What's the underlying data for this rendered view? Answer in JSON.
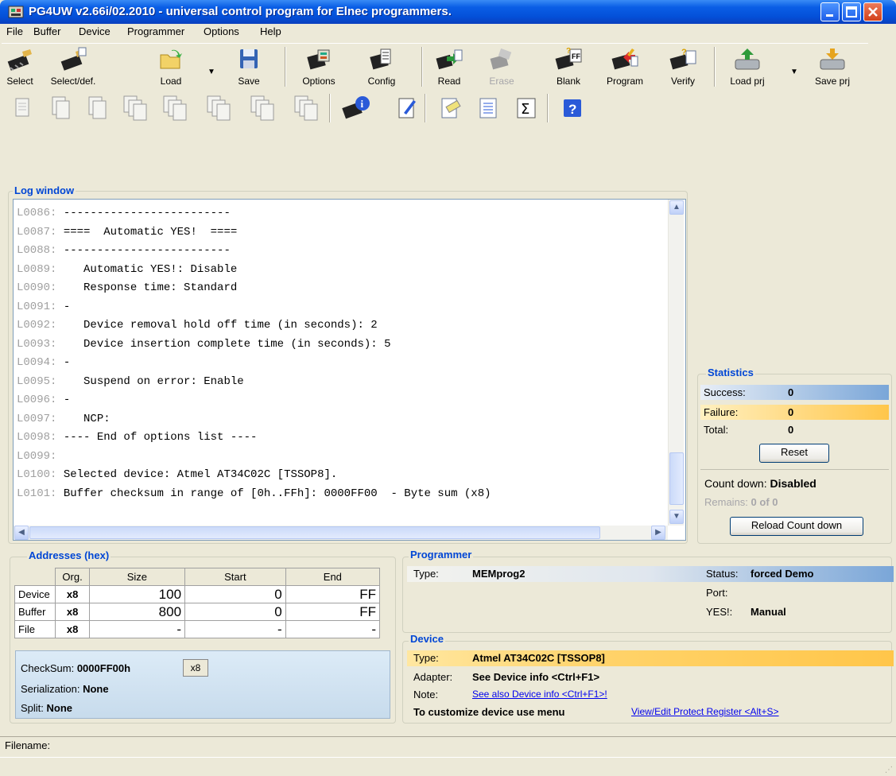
{
  "window": {
    "title": "PG4UW v2.66i/02.2010 - universal control program for Elnec programmers."
  },
  "menu": [
    "File",
    "Buffer",
    "Device",
    "Programmer",
    "Options",
    "Help"
  ],
  "toolbar": {
    "select": "Select",
    "select_def": "Select/def.",
    "load": "Load",
    "save": "Save",
    "options": "Options",
    "config": "Config",
    "read": "Read",
    "erase": "Erase",
    "blank": "Blank",
    "program": "Program",
    "verify": "Verify",
    "load_prj": "Load prj",
    "save_prj": "Save prj",
    "blank_badge": "FF",
    "checksum_glyph": "Σ",
    "help_glyph": "?"
  },
  "log": {
    "title": "Log window",
    "lines": [
      {
        "n": "L0086:",
        "t": " -------------------------"
      },
      {
        "n": "L0087:",
        "t": " ====  Automatic YES!  ===="
      },
      {
        "n": "L0088:",
        "t": " -------------------------"
      },
      {
        "n": "L0089:",
        "t": "    Automatic YES!: Disable"
      },
      {
        "n": "L0090:",
        "t": "    Response time: Standard"
      },
      {
        "n": "L0091:",
        "t": " -"
      },
      {
        "n": "L0092:",
        "t": "    Device removal hold off time (in seconds): 2"
      },
      {
        "n": "L0093:",
        "t": "    Device insertion complete time (in seconds): 5"
      },
      {
        "n": "L0094:",
        "t": " -"
      },
      {
        "n": "L0095:",
        "t": "    Suspend on error: Enable"
      },
      {
        "n": "L0096:",
        "t": " -"
      },
      {
        "n": "L0097:",
        "t": "    NCP:"
      },
      {
        "n": "L0098:",
        "t": " ---- End of options list ----"
      },
      {
        "n": "L0099:",
        "t": ""
      },
      {
        "n": "L0100:",
        "t": " Selected device: Atmel AT34C02C [TSSOP8]."
      },
      {
        "n": "L0101:",
        "t": " Buffer checksum in range of [0h..FFh]: 0000FF00  - Byte sum (x8)"
      }
    ],
    "scroll_up": "▲",
    "scroll_down": "▼",
    "scroll_left": "◀",
    "scroll_right": "▶"
  },
  "statistics": {
    "title": "Statistics",
    "success_label": "Success:",
    "success_value": "0",
    "failure_label": "Failure:",
    "failure_value": "0",
    "total_label": "Total:",
    "total_value": "0",
    "reset": "Reset",
    "countdown_label": "Count down:",
    "countdown_value": "Disabled",
    "remains_label": "Remains:",
    "remains_value": "0 of 0",
    "reload": "Reload Count down",
    "success_color": "#7aa6d8",
    "failure_color": "#ffc64a"
  },
  "addresses": {
    "title": "Addresses (hex)",
    "headers": [
      "Org.",
      "Size",
      "Start",
      "End"
    ],
    "rows": [
      {
        "name": "Device",
        "org": "x8",
        "size": "100",
        "start": "0",
        "end": "FF"
      },
      {
        "name": "Buffer",
        "org": "x8",
        "size": "800",
        "start": "0",
        "end": "FF"
      },
      {
        "name": "File",
        "org": "x8",
        "size": "-",
        "start": "-",
        "end": "-"
      }
    ],
    "checksum_label": "CheckSum:",
    "checksum_value": "0000FF00h",
    "checksum_mode": "x8",
    "serialization_label": "Serialization:",
    "serialization_value": "None",
    "split_label": "Split:",
    "split_value": "None"
  },
  "programmer": {
    "title": "Programmer",
    "type_label": "Type:",
    "type_value": "MEMprog2",
    "status_label": "Status:",
    "status_value": "forced Demo",
    "port_label": "Port:",
    "yes_label": "YES!:",
    "yes_value": "Manual"
  },
  "device": {
    "title": "Device",
    "type_label": "Type:",
    "type_value": "Atmel  AT34C02C [TSSOP8]",
    "adapter_label": "Adapter:",
    "adapter_value": "See Device info <Ctrl+F1>",
    "note_label": "Note:",
    "note_link": "See also Device info <Ctrl+F1>!",
    "customize_text": "To customize device use menu",
    "customize_link": "View/Edit Protect Register <Alt+S>"
  },
  "statusbar": {
    "filename_label": "Filename:"
  }
}
